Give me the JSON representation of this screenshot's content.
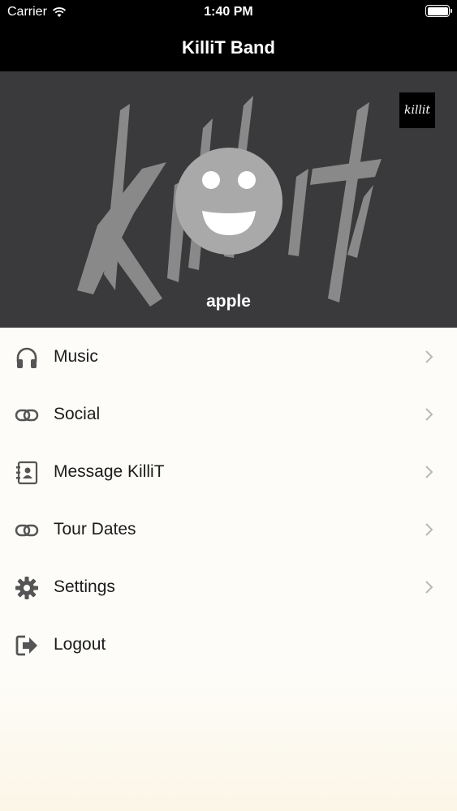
{
  "status_bar": {
    "carrier": "Carrier",
    "time": "1:40 PM"
  },
  "nav_bar": {
    "title": "KilliT Band"
  },
  "header": {
    "small_logo_text": "killit",
    "username": "apple"
  },
  "menu": {
    "items": [
      {
        "label": "Music",
        "icon": "headphones-icon",
        "chevron": true
      },
      {
        "label": "Social",
        "icon": "link-icon",
        "chevron": true
      },
      {
        "label": "Message KilliT",
        "icon": "contacts-book-icon",
        "chevron": true
      },
      {
        "label": "Tour Dates",
        "icon": "link-icon",
        "chevron": true
      },
      {
        "label": "Settings",
        "icon": "gear-icon",
        "chevron": true
      },
      {
        "label": "Logout",
        "icon": "logout-icon",
        "chevron": false
      }
    ]
  },
  "colors": {
    "bar": "#000000",
    "header_bg": "#3a393b",
    "menu_bg": "#fdfcf8",
    "icon": "#555555",
    "chevron": "#b9b9b9"
  }
}
